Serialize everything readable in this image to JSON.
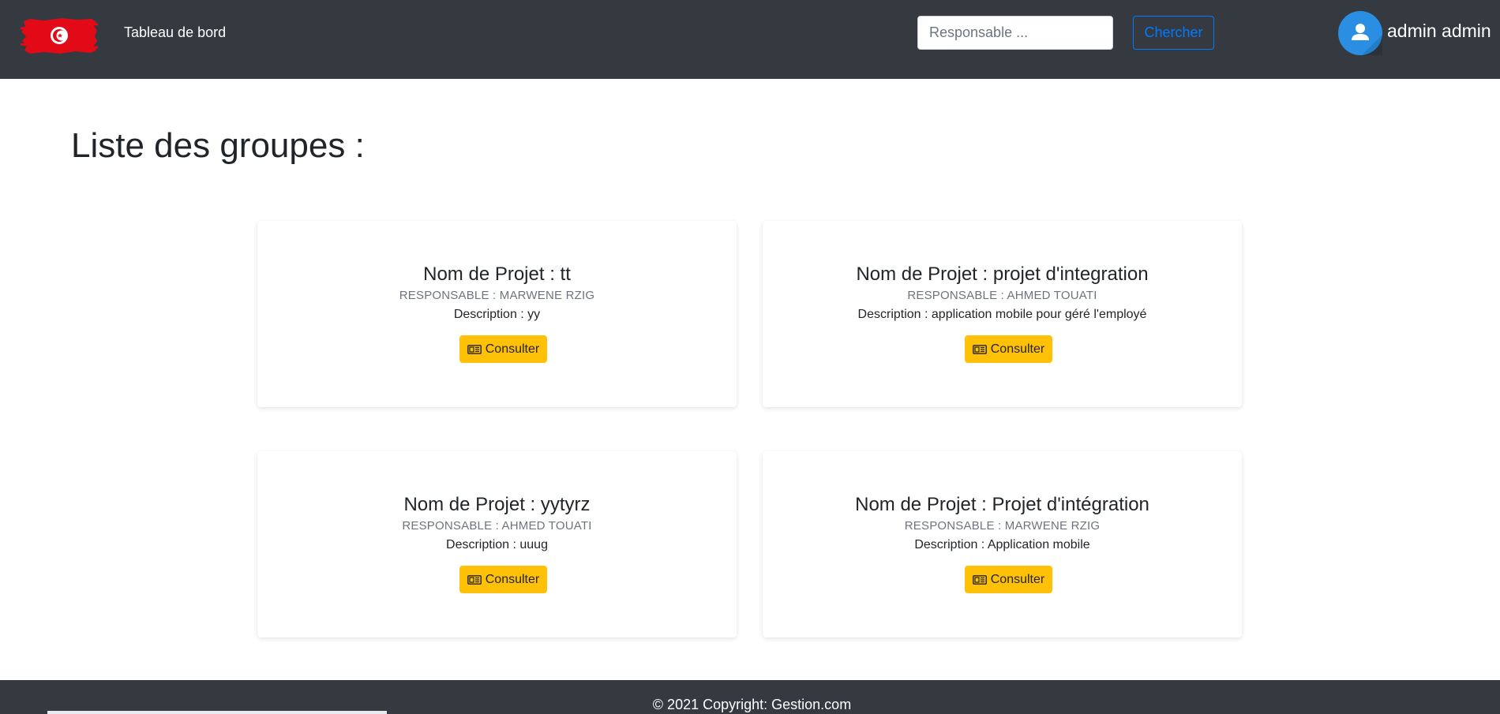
{
  "navbar": {
    "brand": "Tableau de bord",
    "search_placeholder": "Responsable ...",
    "search_button": "Chercher",
    "user_name": "admin admin"
  },
  "page": {
    "title": "Liste des groupes :"
  },
  "groups": [
    {
      "title": "Nom de Projet : tt",
      "responsable": "Responsable : Marwene Rzig",
      "description": "Description : yy",
      "button": "Consulter"
    },
    {
      "title": "Nom de Projet : projet d'integration",
      "responsable": "Responsable : Ahmed Touati",
      "description": "Description : application mobile pour géré l'employé",
      "button": "Consulter"
    },
    {
      "title": "Nom de Projet : yytyrz",
      "responsable": "Responsable : Ahmed Touati",
      "description": "Description : uuug",
      "button": "Consulter"
    },
    {
      "title": "Nom de Projet : Projet d'intégration",
      "responsable": "Responsable : Marwene Rzig",
      "description": "Description : Application mobile",
      "button": "Consulter"
    }
  ],
  "footer": {
    "copyright": "© 2021 Copyright: Gestion.com"
  },
  "colors": {
    "navbar": "#343a40",
    "accent_button": "#ffc107",
    "primary": "#007bff",
    "avatar": "#2a8fe3",
    "flag_red": "#e30a17"
  },
  "icons": {
    "flag": "tunisia-flag-icon",
    "avatar": "user-avatar-icon",
    "consult": "id-card-icon"
  }
}
